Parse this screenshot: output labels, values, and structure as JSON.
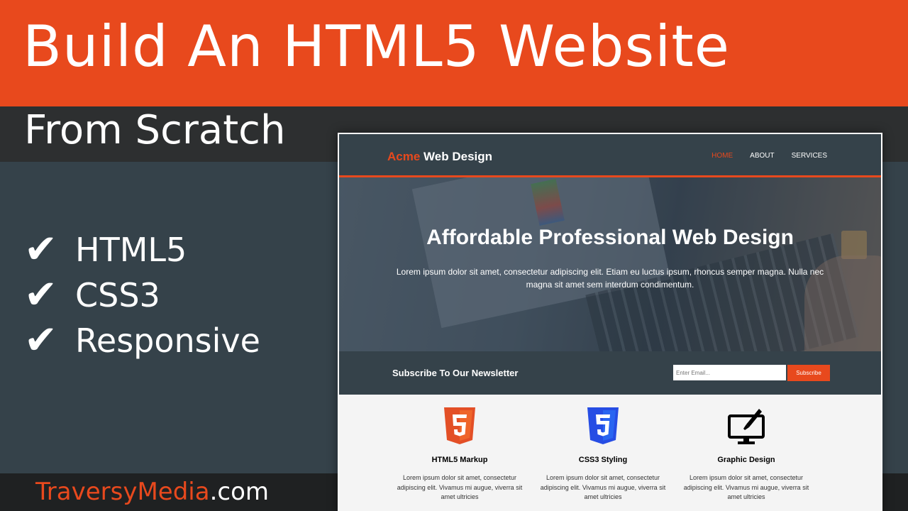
{
  "title": {
    "line1": "Build An HTML5 Website",
    "line2": "From Scratch"
  },
  "checklist": [
    {
      "icon": "checkmark-icon",
      "mark": "✔",
      "label": "HTML5"
    },
    {
      "icon": "checkmark-icon",
      "mark": "✔",
      "label": "CSS3"
    },
    {
      "icon": "checkmark-icon",
      "mark": "✔",
      "label": "Responsive"
    }
  ],
  "footer": {
    "brand": "TraversyMedia",
    "tld": ".com"
  },
  "site": {
    "logo_highlight": "Acme",
    "logo_rest": " Web Design",
    "nav": [
      {
        "label": "HOME",
        "active": true
      },
      {
        "label": "ABOUT",
        "active": false
      },
      {
        "label": "SERVICES",
        "active": false
      }
    ],
    "hero": {
      "title": "Affordable Professional Web Design",
      "text": "Lorem ipsum dolor sit amet, consectetur adipiscing elit. Etiam eu luctus ipsum, rhoncus semper magna. Nulla nec magna sit amet sem interdum condimentum."
    },
    "newsletter": {
      "title": "Subscribe To Our Newsletter",
      "placeholder": "Enter Email...",
      "button": "Subscribe"
    },
    "boxes": [
      {
        "icon": "html5-logo-icon",
        "title": "HTML5 Markup",
        "text": "Lorem ipsum dolor sit amet, consectetur adipiscing elit. Vivamus mi augue, viverra sit amet ultricies"
      },
      {
        "icon": "css3-logo-icon",
        "title": "CSS3 Styling",
        "text": "Lorem ipsum dolor sit amet, consectetur adipiscing elit. Vivamus mi augue, viverra sit amet ultricies"
      },
      {
        "icon": "monitor-brush-icon",
        "title": "Graphic Design",
        "text": "Lorem ipsum dolor sit amet, consectetur adipiscing elit. Vivamus mi augue, viverra sit amet ultricies"
      }
    ]
  },
  "colors": {
    "accent": "#e8491d",
    "dark": "#35424a",
    "band": "#2d2f30"
  }
}
